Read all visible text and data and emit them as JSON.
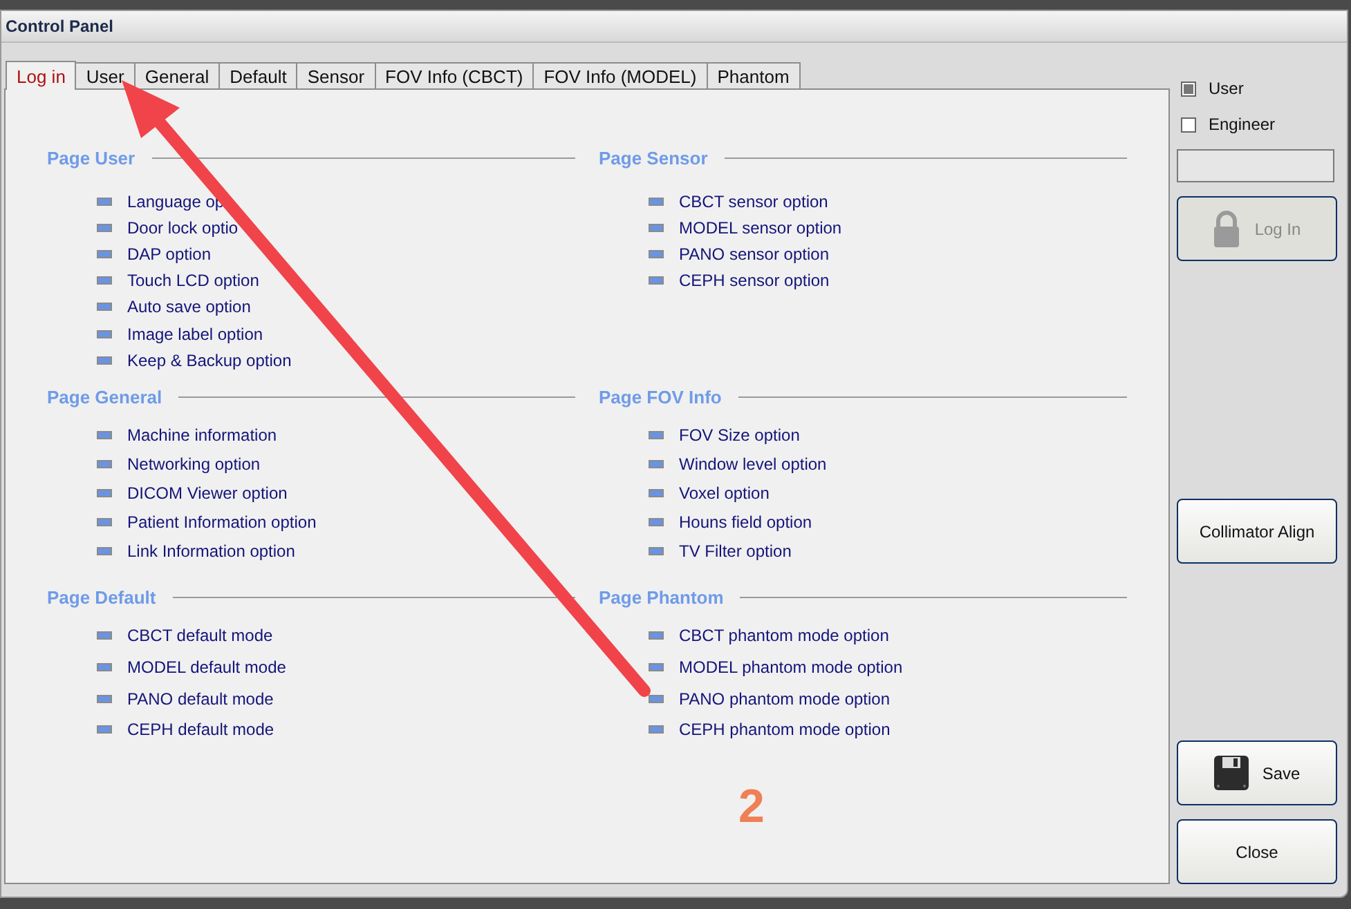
{
  "window": {
    "title": "Control Panel"
  },
  "tabs": [
    {
      "label": "Log in",
      "selected": true
    },
    {
      "label": "User",
      "selected": false
    },
    {
      "label": "General",
      "selected": false
    },
    {
      "label": "Default",
      "selected": false
    },
    {
      "label": "Sensor",
      "selected": false
    },
    {
      "label": "FOV Info (CBCT)",
      "selected": false
    },
    {
      "label": "FOV Info (MODEL)",
      "selected": false
    },
    {
      "label": "Phantom",
      "selected": false
    }
  ],
  "sections": [
    {
      "title": "Page User",
      "items": [
        "Language op",
        "Door lock optio",
        "DAP option",
        "Touch LCD option",
        "Auto save option",
        "Image label option",
        "Keep & Backup option"
      ]
    },
    {
      "title": "Page Sensor",
      "items": [
        "CBCT sensor option",
        "MODEL sensor option",
        "PANO sensor option",
        "CEPH sensor option"
      ]
    },
    {
      "title": "Page General",
      "items": [
        "Machine information",
        "Networking option",
        "DICOM Viewer option",
        "Patient Information option",
        "Link Information option"
      ]
    },
    {
      "title": "Page FOV Info",
      "items": [
        "FOV Size option",
        "Window level option",
        "Voxel option",
        "Houns field option",
        "TV Filter option"
      ]
    },
    {
      "title": "Page Default",
      "items": [
        "CBCT default mode",
        "MODEL default mode",
        "PANO default mode",
        "CEPH default mode"
      ]
    },
    {
      "title": "Page Phantom",
      "items": [
        "CBCT phantom mode option",
        "MODEL phantom mode option",
        "PANO phantom mode option",
        "CEPH phantom mode option"
      ]
    }
  ],
  "login": {
    "roles": [
      {
        "label": "User",
        "checked": true
      },
      {
        "label": "Engineer",
        "checked": false
      }
    ],
    "login_button": {
      "label": "Log In",
      "disabled": true
    }
  },
  "buttons": [
    {
      "kind": "plain",
      "label": "Collimator Align"
    },
    {
      "kind": "save",
      "label": "Save"
    },
    {
      "kind": "plain",
      "label": "Close"
    }
  ],
  "annotation": {
    "label": "2"
  }
}
